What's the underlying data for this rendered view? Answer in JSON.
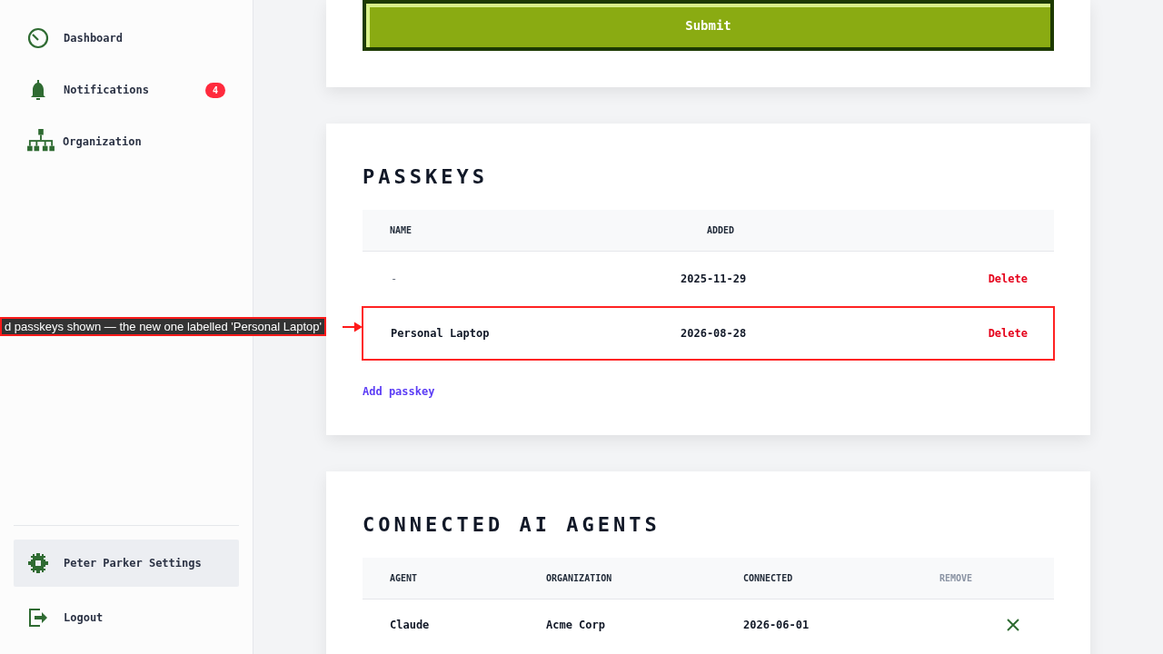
{
  "sidebar": {
    "items": [
      {
        "label": "Dashboard",
        "selected": false
      },
      {
        "label": "Notifications",
        "badge": "4",
        "selected": false
      },
      {
        "label": "Organization",
        "selected": false
      }
    ],
    "bottom_items": [
      {
        "label": "Peter Parker Settings",
        "selected": true
      },
      {
        "label": "Logout",
        "selected": false
      }
    ]
  },
  "form": {
    "submit_button": "Submit"
  },
  "passkeys": {
    "title": "PASSKEYS",
    "columns": [
      "NAME",
      "ADDED"
    ],
    "rows": [
      {
        "name": "-",
        "added": "2025-11-29",
        "action": "Delete",
        "highlighted": false
      },
      {
        "name": "Personal Laptop",
        "added": "2026-08-28",
        "action": "Delete",
        "highlighted": true
      }
    ],
    "add_link": "Add passkey"
  },
  "agents": {
    "title": "CONNECTED AI AGENTS",
    "columns": [
      "AGENT",
      "ORGANIZATION",
      "CONNECTED",
      "REMOVE"
    ],
    "rows": [
      {
        "agent": "Claude",
        "organization": "Acme Corp",
        "connected": "2026-06-01"
      }
    ]
  },
  "annotation": {
    "text": "d passkeys shown — the new one labelled 'Personal Laptop'"
  }
}
